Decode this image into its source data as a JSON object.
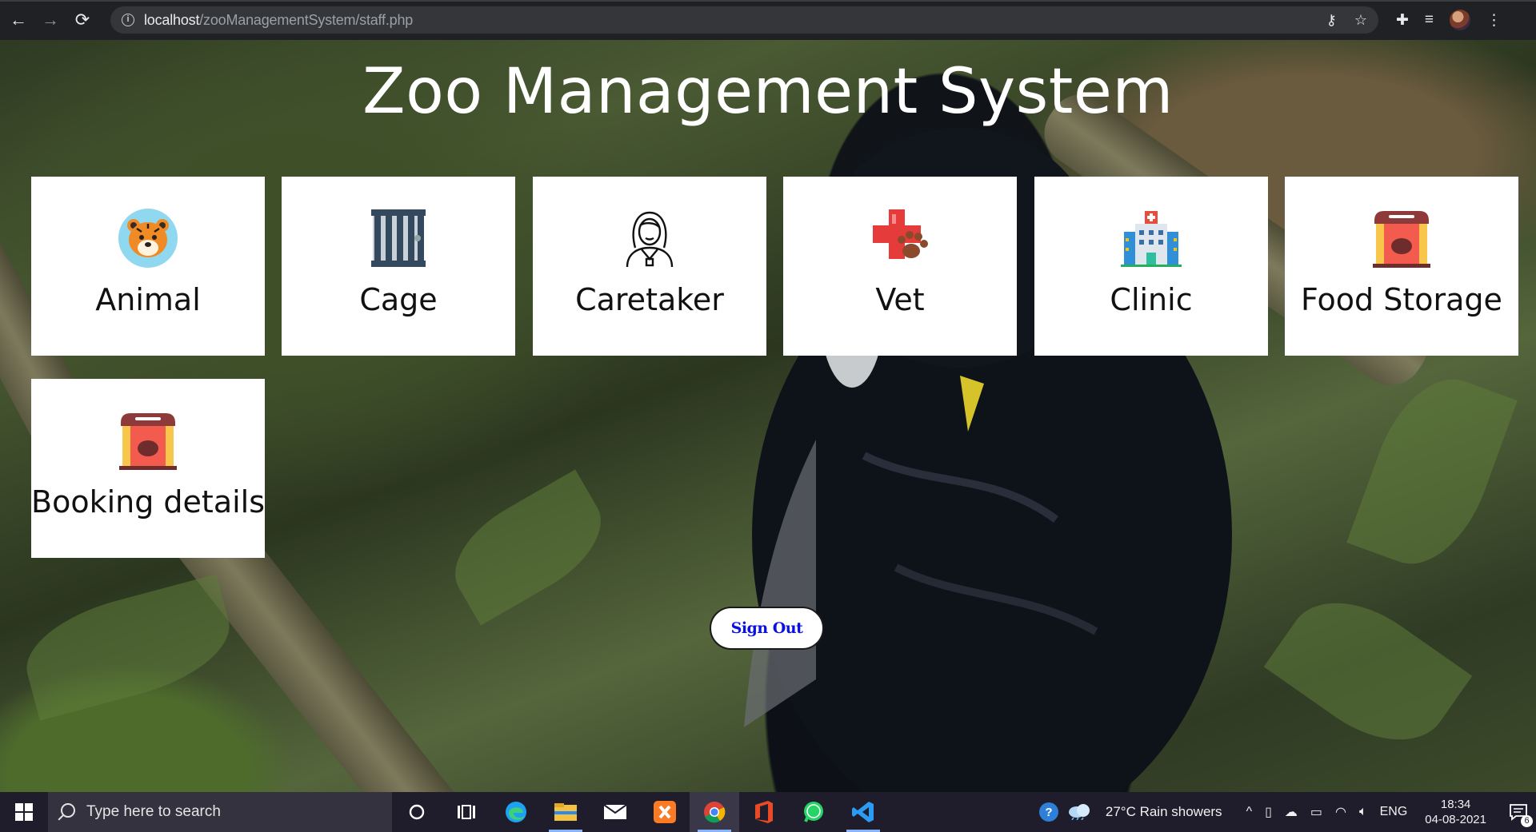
{
  "browser": {
    "url_host": "localhost",
    "url_path": "/zooManagementSystem/staff.php",
    "back_icon": "←",
    "forward_icon": "→",
    "reload_icon": "⟳",
    "key_icon": "⚷",
    "star_icon": "☆",
    "extensions_icon": "✚",
    "media_icon": "≡",
    "menu_icon": "⋮",
    "info_icon": "i"
  },
  "page": {
    "title": "Zoo Management System",
    "cards": [
      {
        "label": "Animal",
        "icon": "tiger-icon"
      },
      {
        "label": "Cage",
        "icon": "cage-icon"
      },
      {
        "label": "Caretaker",
        "icon": "caretaker-icon"
      },
      {
        "label": "Vet",
        "icon": "vet-icon"
      },
      {
        "label": "Clinic",
        "icon": "clinic-icon"
      },
      {
        "label": "Food Storage",
        "icon": "food-storage-icon"
      },
      {
        "label": "Booking details",
        "icon": "food-storage-icon"
      }
    ],
    "signout_label": "Sign Out"
  },
  "taskbar": {
    "search_placeholder": "Type here to search",
    "weather": "27°C  Rain showers",
    "language": "ENG",
    "time": "18:34",
    "date": "04-08-2021",
    "notifications_count": "6",
    "chevron": "^"
  },
  "colors": {
    "accent_signout": "#0a10e0",
    "card_bg": "#ffffff",
    "chrome_bg": "#202124",
    "taskbar_bg": "#1f1d2b"
  }
}
